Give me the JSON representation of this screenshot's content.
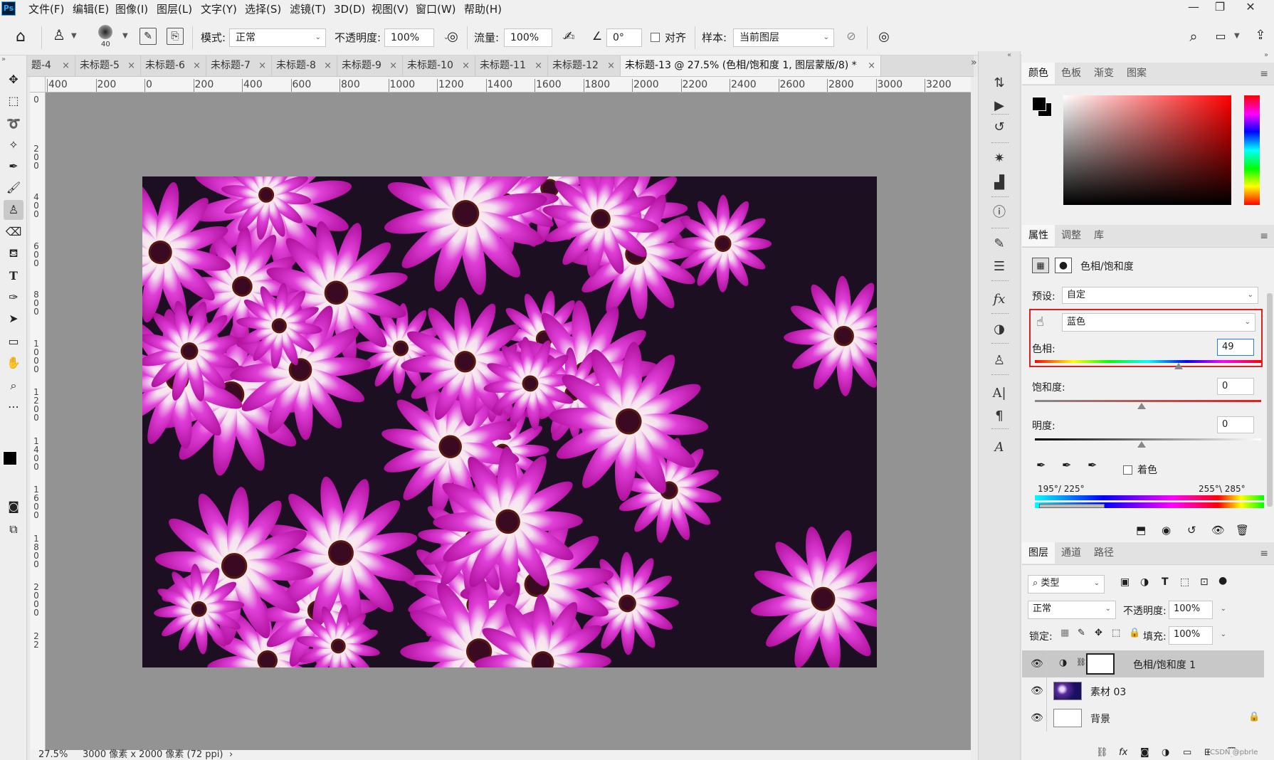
{
  "app": {
    "logo": "Ps"
  },
  "menu": [
    "文件(F)",
    "编辑(E)",
    "图像(I)",
    "图层(L)",
    "文字(Y)",
    "选择(S)",
    "滤镜(T)",
    "3D(D)",
    "视图(V)",
    "窗口(W)",
    "帮助(H)"
  ],
  "window_controls": {
    "minimize": "—",
    "restore": "❐",
    "close": "✕"
  },
  "options": {
    "brush_size": "40",
    "mode_label": "模式:",
    "mode_value": "正常",
    "opacity_label": "不透明度:",
    "opacity_value": "100%",
    "flow_label": "流量:",
    "flow_value": "100%",
    "angle_value": "0°",
    "align_label": "对齐",
    "sample_label": "样本:",
    "sample_value": "当前图层"
  },
  "tabs": [
    {
      "label": "题-4"
    },
    {
      "label": "未标题-5"
    },
    {
      "label": "未标题-6"
    },
    {
      "label": "未标题-7"
    },
    {
      "label": "未标题-8"
    },
    {
      "label": "未标题-9"
    },
    {
      "label": "未标题-10"
    },
    {
      "label": "未标题-11"
    },
    {
      "label": "未标题-12"
    },
    {
      "label": "未标题-13 @ 27.5% (色相/饱和度 1, 图层蒙版/8) *"
    }
  ],
  "ruler_h": [
    "400",
    "200",
    "0",
    "200",
    "400",
    "600",
    "800",
    "1000",
    "1200",
    "1400",
    "1600",
    "1800",
    "2000",
    "2200",
    "2400",
    "2600",
    "2800",
    "3000",
    "3200"
  ],
  "ruler_v": [
    "0",
    "2 0 0",
    "4 0 0",
    "6 0 0",
    "8 0 0",
    "1 0 0 0",
    "1 2 0 0",
    "1 4 0 0",
    "1 6 0 0",
    "1 8 0 0",
    "2 0 0 0",
    "2 2"
  ],
  "status": {
    "zoom": "27.5%",
    "doc_info": "3000 像素 x 2000 像素 (72 ppi)",
    "arrow": "›"
  },
  "color_panel": {
    "tabs": [
      "颜色",
      "色板",
      "渐变",
      "图案"
    ]
  },
  "properties": {
    "tabs": [
      "属性",
      "调整",
      "库"
    ],
    "title": "色相/饱和度",
    "preset_label": "预设:",
    "preset_value": "自定",
    "channel_value": "蓝色",
    "hue_label": "色相:",
    "hue_value": "49",
    "saturation_label": "饱和度:",
    "saturation_value": "0",
    "lightness_label": "明度:",
    "lightness_value": "0",
    "colorize_label": "着色",
    "range_left": "195°/ 225°",
    "range_right": "255°\\ 285°"
  },
  "layers": {
    "tabs": [
      "图层",
      "通道",
      "路径"
    ],
    "filter_value": "类型",
    "blend_value": "正常",
    "opacity_label": "不透明度:",
    "opacity_value": "100%",
    "lock_label": "锁定:",
    "fill_label": "填充:",
    "fill_value": "100%",
    "items": [
      {
        "name": "色相/饱和度 1"
      },
      {
        "name": "素材 03"
      },
      {
        "name": "背景"
      }
    ]
  },
  "watermark": "CSDN @pbrle",
  "colors": {
    "accent_red": "#e02020",
    "flower_magenta": "#d41ec4"
  }
}
